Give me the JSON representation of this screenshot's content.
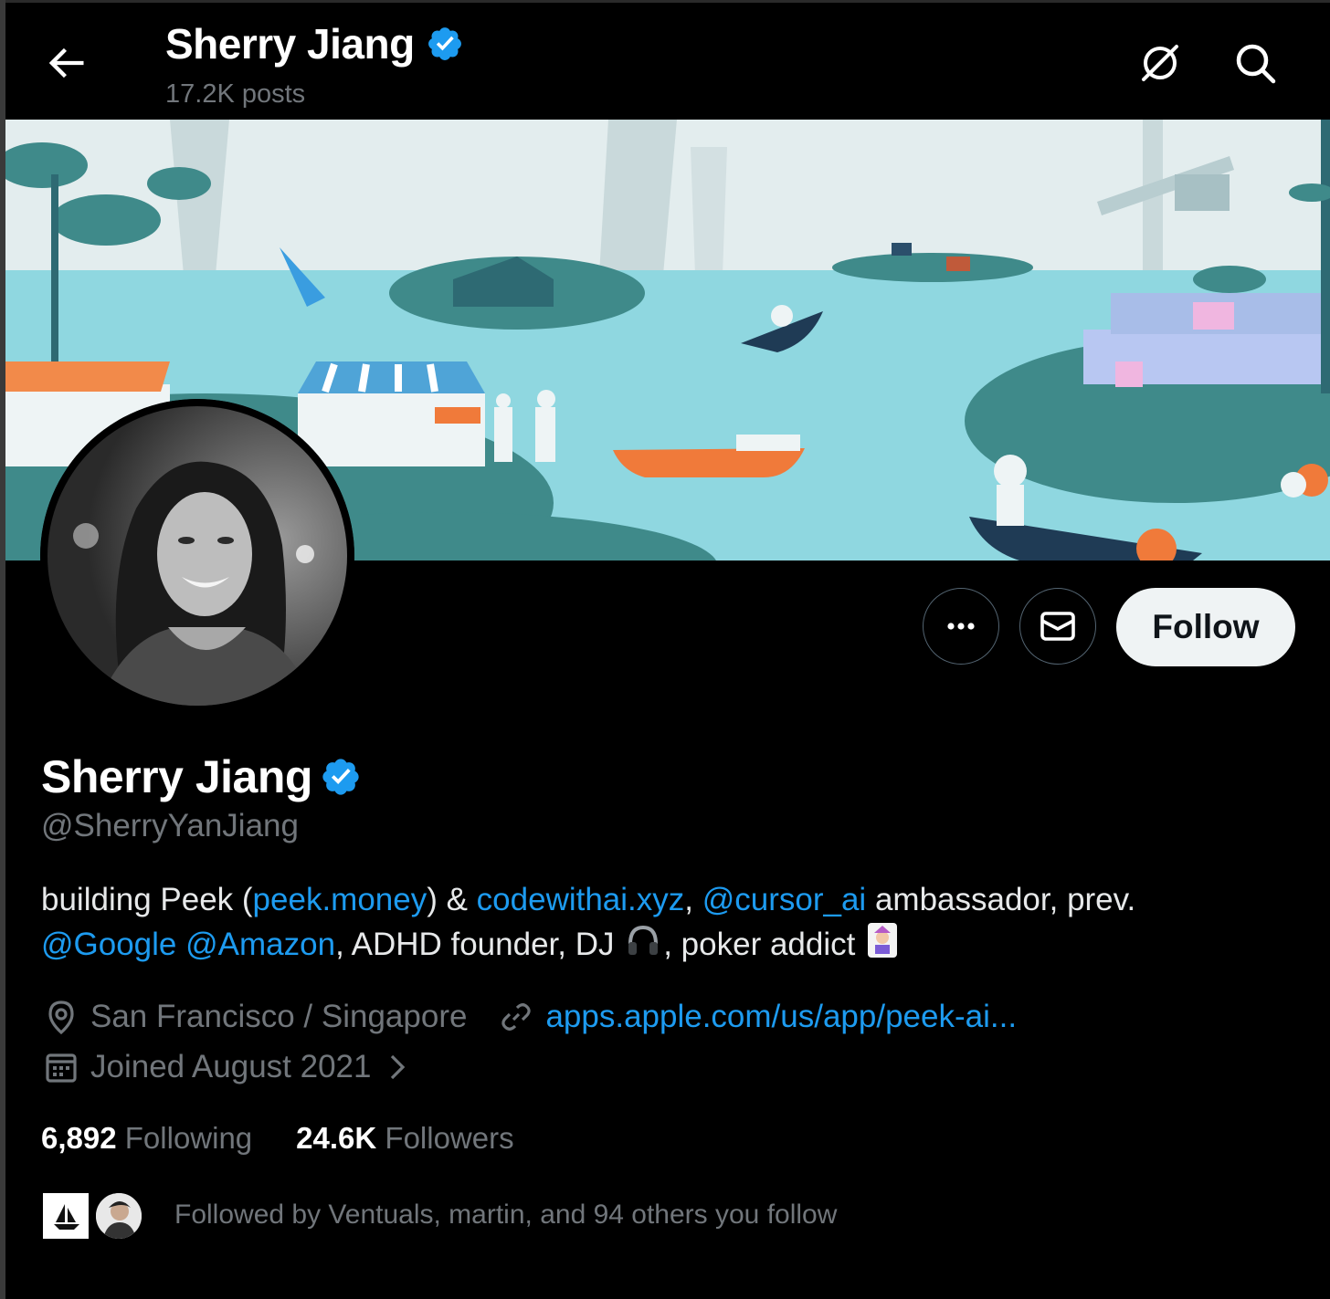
{
  "header": {
    "name": "Sherry Jiang",
    "posts": "17.2K posts",
    "back_icon": "arrow-left-icon",
    "grok_icon": "grok-icon",
    "search_icon": "search-icon"
  },
  "profile": {
    "name": "Sherry Jiang",
    "handle": "@SherryYanJiang",
    "verified_color": "#1d9bf0",
    "bio": {
      "t1": "building Peek (",
      "link1": "peek.money",
      "t2": ") & ",
      "link2": "codewithai.xyz",
      "t3": ", ",
      "link3": "@cursor_ai",
      "t4": " ambassador, prev.",
      "link4": "@Google",
      "t5": " ",
      "link5": "@Amazon",
      "t6": ", ADHD founder, DJ ",
      "t7": ", poker addict "
    },
    "location": "San Francisco / Singapore",
    "website": "apps.apple.com/us/app/peek-ai...",
    "joined": "Joined August 2021",
    "following_count": "6,892",
    "following_label": "Following",
    "followers_count": "24.6K",
    "followers_label": "Followers",
    "followed_by": "Followed by Ventuals, martin, and 94 others you follow"
  },
  "actions": {
    "more_icon": "more-icon",
    "message_icon": "envelope-icon",
    "follow_label": "Follow"
  },
  "colors": {
    "background": "#000000",
    "link": "#1d9bf0",
    "muted": "#71767b",
    "follow_bg": "#eff3f4"
  }
}
